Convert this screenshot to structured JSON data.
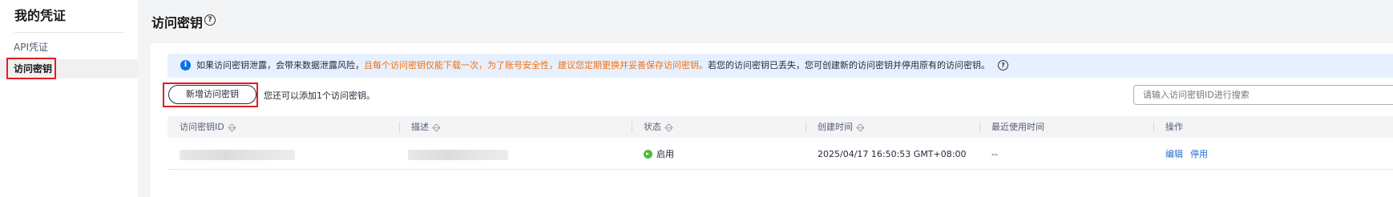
{
  "sidebar": {
    "title": "我的凭证",
    "items": [
      {
        "label": "API凭证"
      },
      {
        "label": "访问密钥"
      }
    ]
  },
  "main": {
    "title": "访问密钥",
    "help_icon": "?",
    "alert": {
      "icon": "info-icon",
      "text_before": "如果访问密钥泄露，会带来数据泄露风险，",
      "text_warning": "且每个访问密钥仅能下载一次，为了账号安全性，建议您定期更换并妥善保存访问密钥。",
      "text_after": "若您的访问密钥已丢失，您可创建新的访问密钥并停用原有的访问密钥。",
      "help_icon": "?",
      "warning_color": "#f66f0c"
    },
    "toolbar": {
      "create_button": "新增访问密钥",
      "quota_text": "您还可以添加1个访问密钥。",
      "search_placeholder": "请输入访问密钥ID进行搜索"
    },
    "table": {
      "columns": [
        "访问密钥ID",
        "描述",
        "状态",
        "创建时间",
        "最近使用时间",
        "操作"
      ],
      "rows": [
        {
          "access_key_id": "",
          "description": "",
          "status": "启用",
          "created_at": "2025/04/17 16:50:53 GMT+08:00",
          "last_used": "--",
          "actions": [
            "编辑",
            "停用"
          ]
        }
      ]
    }
  },
  "colors": {
    "accent": "#1f6fd9",
    "highlight_border": "#e31b23",
    "status_enabled": "#50b83c",
    "info_blue": "#0d6fe8"
  }
}
